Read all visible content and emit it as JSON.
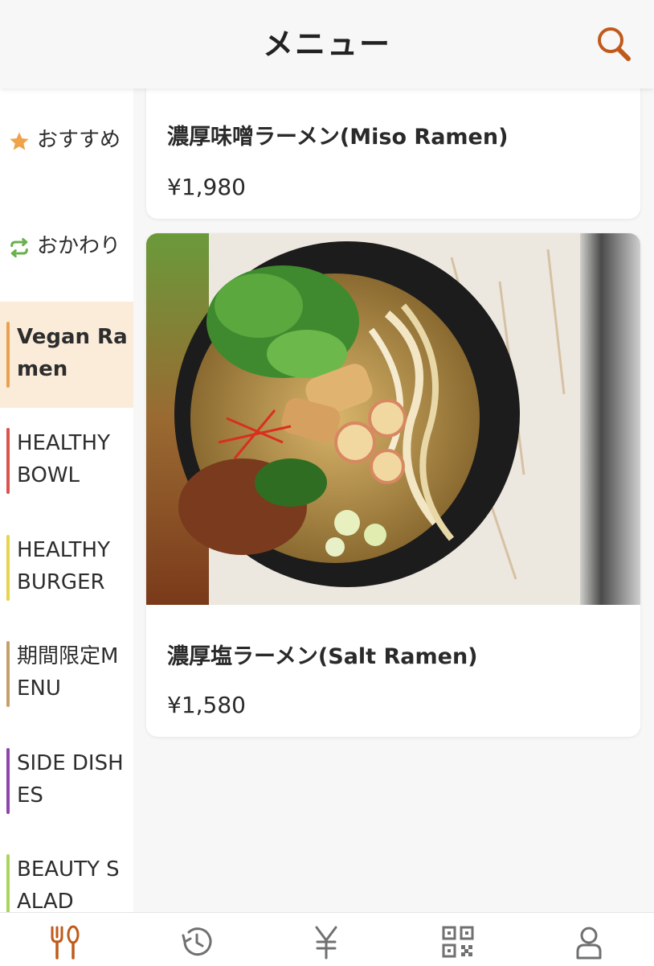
{
  "header": {
    "title": "メニュー"
  },
  "colors": {
    "accent": "#c05a1a",
    "active_bg": "#fbecda",
    "star": "#f0a24a",
    "refill": "#6ab04c"
  },
  "sidebar": {
    "items": [
      {
        "label": "おすすめ",
        "icon": "star-icon"
      },
      {
        "label": "おかわり",
        "icon": "refresh-icon"
      },
      {
        "label": "Vegan Ramen",
        "bar_color": "#e9a050"
      },
      {
        "label": "HEALTHY BOWL",
        "bar_color": "#d9534f"
      },
      {
        "label": "HEALTHY BURGER",
        "bar_color": "#e6d44a"
      },
      {
        "label": "期間限定MENU",
        "bar_color": "#c4a06a"
      },
      {
        "label": "SIDE DISHES",
        "bar_color": "#8e44ad"
      },
      {
        "label": "BEAUTY SALAD",
        "bar_color": "#a8d65a"
      }
    ]
  },
  "menu_items": [
    {
      "title": "濃厚味噌ラーメン(Miso Ramen)",
      "price": "¥1,980"
    },
    {
      "title": "濃厚塩ラーメン(Salt Ramen)",
      "price": "¥1,580"
    }
  ],
  "tabbar": {
    "items": [
      {
        "icon": "fork-knife-icon",
        "active": true
      },
      {
        "icon": "history-icon",
        "active": false
      },
      {
        "icon": "yen-icon",
        "active": false
      },
      {
        "icon": "qr-code-icon",
        "active": false
      },
      {
        "icon": "user-icon",
        "active": false
      }
    ]
  }
}
